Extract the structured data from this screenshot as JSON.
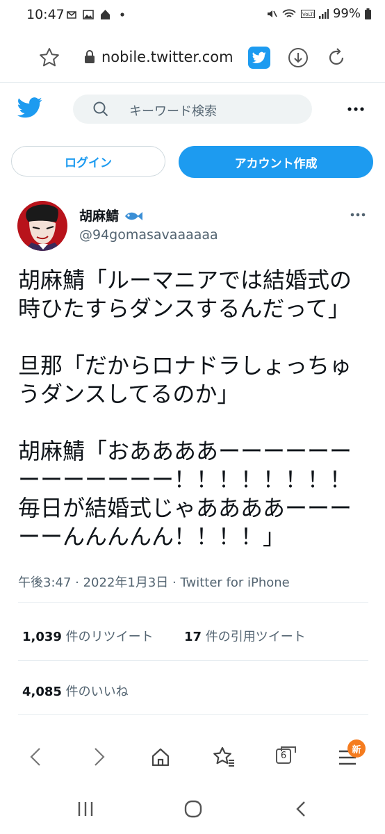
{
  "status_bar": {
    "time": "10:47",
    "battery": "99%",
    "icons": [
      "mail-icon",
      "image-icon",
      "home-icon",
      "dot-icon",
      "mute-icon",
      "wifi-icon",
      "volte-icon",
      "signal-icon",
      "battery-icon"
    ]
  },
  "browser": {
    "url": "nobile.twitter.com",
    "icons": [
      "star-icon",
      "lock-icon",
      "twitter-extension-icon",
      "download-icon",
      "reload-icon"
    ]
  },
  "header": {
    "search_placeholder": "キーワード検索",
    "icons": [
      "twitter-logo-icon",
      "search-icon",
      "more-icon"
    ]
  },
  "auth": {
    "login_label": "ログイン",
    "signup_label": "アカウント作成"
  },
  "tweet": {
    "display_name": "胡麻鯖",
    "display_name_emoji": "fish-icon",
    "handle": "@94gomasavaaaaaa",
    "text": "胡麻鯖「ルーマニアでは結婚式の時ひたすらダンスするんだって」\n\n旦那「だからロナドラしょっちゅうダンスしてるのか」\n\n胡麻鯖「おああああーーーーーーーーーーーーー！！！！！！！！毎日が結婚式じゃああああーーーーーんんんんん！！！！」",
    "meta": "午後3:47 · 2022年1月3日 · Twitter for iPhone",
    "retweets_count": "1,039",
    "retweets_label": " 件のリツイート",
    "quotes_count": "17",
    "quotes_label": " 件の引用ツイート",
    "likes_count": "4,085",
    "likes_label": " 件のいいね"
  },
  "browser_toolbar": {
    "tab_count": "6",
    "menu_badge": "新",
    "icons": [
      "back-icon",
      "forward-icon",
      "home-icon",
      "bookmarks-icon",
      "tabs-icon",
      "menu-icon"
    ]
  },
  "system_nav": {
    "icons": [
      "recents-icon",
      "home-circle-icon",
      "back-icon"
    ]
  },
  "colors": {
    "twitter_blue": "#1d9bf0",
    "text_primary": "#0f1419",
    "text_secondary": "#536471",
    "badge_orange": "#f57c1f"
  }
}
